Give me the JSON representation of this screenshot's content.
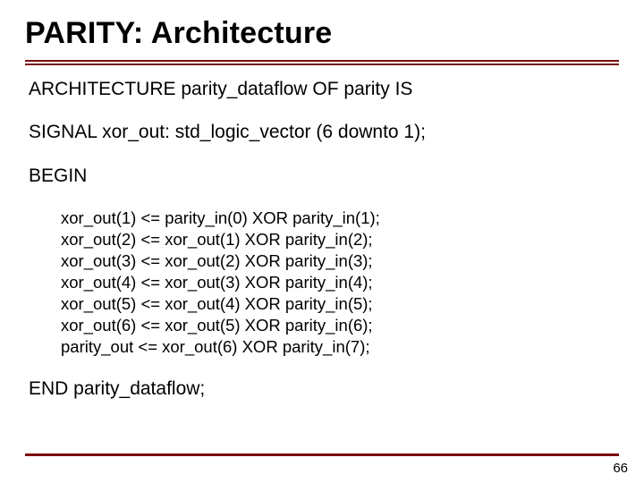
{
  "title": "PARITY: Architecture",
  "lines": {
    "arch_decl": "ARCHITECTURE parity_dataflow OF parity IS",
    "signal_decl": "SIGNAL xor_out: std_logic_vector (6 downto 1);",
    "begin": "BEGIN",
    "end": "END parity_dataflow;"
  },
  "stmts": [
    "xor_out(1) <= parity_in(0) XOR parity_in(1);",
    "xor_out(2) <= xor_out(1) XOR parity_in(2);",
    "xor_out(3) <= xor_out(2) XOR parity_in(3);",
    "xor_out(4) <= xor_out(3) XOR parity_in(4);",
    "xor_out(5) <= xor_out(4) XOR parity_in(5);",
    "xor_out(6) <= xor_out(5) XOR parity_in(6);",
    "parity_out <= xor_out(6) XOR parity_in(7);"
  ],
  "page_number": "66"
}
